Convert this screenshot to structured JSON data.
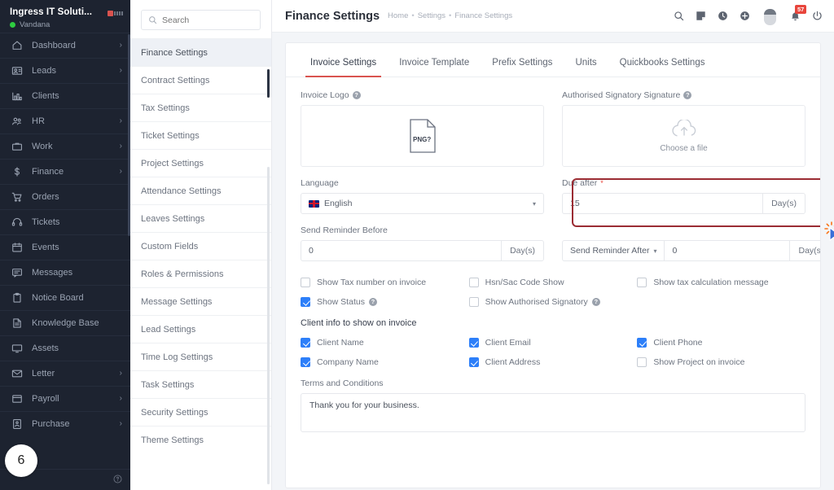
{
  "sidebar": {
    "brand": {
      "name": "Ingress IT Soluti...",
      "user": "Vandana",
      "status": "online"
    },
    "items": [
      {
        "label": "Dashboard",
        "icon": "home-icon",
        "caret": "›"
      },
      {
        "label": "Leads",
        "icon": "leads-icon",
        "caret": "›"
      },
      {
        "label": "Clients",
        "icon": "clients-icon",
        "caret": ""
      },
      {
        "label": "HR",
        "icon": "hr-icon",
        "caret": "›"
      },
      {
        "label": "Work",
        "icon": "work-icon",
        "caret": "›"
      },
      {
        "label": "Finance",
        "icon": "dollar-icon",
        "caret": "›"
      },
      {
        "label": "Orders",
        "icon": "cart-icon",
        "caret": ""
      },
      {
        "label": "Tickets",
        "icon": "headset-icon",
        "caret": ""
      },
      {
        "label": "Events",
        "icon": "calendar-icon",
        "caret": ""
      },
      {
        "label": "Messages",
        "icon": "message-icon",
        "caret": ""
      },
      {
        "label": "Notice Board",
        "icon": "clipboard-icon",
        "caret": ""
      },
      {
        "label": "Knowledge Base",
        "icon": "book-icon",
        "caret": ""
      },
      {
        "label": "Assets",
        "icon": "monitor-icon",
        "caret": ""
      },
      {
        "label": "Letter",
        "icon": "envelope-icon",
        "caret": "›"
      },
      {
        "label": "Payroll",
        "icon": "payroll-icon",
        "caret": "›"
      },
      {
        "label": "Purchase",
        "icon": "purchase-icon",
        "caret": "›"
      }
    ],
    "footer_help_icon": "help-icon",
    "overlay_badge": "6"
  },
  "settings_panel": {
    "search_placeholder": "Search",
    "search_value": "",
    "items": [
      {
        "label": "Finance Settings",
        "active": true
      },
      {
        "label": "Contract Settings",
        "active": false
      },
      {
        "label": "Tax Settings",
        "active": false
      },
      {
        "label": "Ticket Settings",
        "active": false
      },
      {
        "label": "Project Settings",
        "active": false
      },
      {
        "label": "Attendance Settings",
        "active": false
      },
      {
        "label": "Leaves Settings",
        "active": false
      },
      {
        "label": "Custom Fields",
        "active": false
      },
      {
        "label": "Roles & Permissions",
        "active": false
      },
      {
        "label": "Message Settings",
        "active": false
      },
      {
        "label": "Lead Settings",
        "active": false
      },
      {
        "label": "Time Log Settings",
        "active": false
      },
      {
        "label": "Task Settings",
        "active": false
      },
      {
        "label": "Security Settings",
        "active": false
      },
      {
        "label": "Theme Settings",
        "active": false
      }
    ]
  },
  "header": {
    "title": "Finance Settings",
    "breadcrumb": [
      "Home",
      "Settings",
      "Finance Settings"
    ],
    "breadcrumb_sep": "•",
    "icons": [
      "search-icon",
      "note-icon",
      "clock-icon",
      "plus-circle-icon",
      "avatar",
      "bell-icon",
      "power-icon"
    ],
    "notification_count": "57"
  },
  "tabs": [
    {
      "label": "Invoice Settings",
      "active": true
    },
    {
      "label": "Invoice Template",
      "active": false
    },
    {
      "label": "Prefix Settings",
      "active": false
    },
    {
      "label": "Units",
      "active": false
    },
    {
      "label": "Quickbooks Settings",
      "active": false
    }
  ],
  "form": {
    "invoice_logo": {
      "label": "Invoice Logo",
      "file_badge": "PNG?"
    },
    "signature": {
      "label": "Authorised Signatory Signature",
      "choose": "Choose a file"
    },
    "language": {
      "label": "Language",
      "value": "English"
    },
    "due_after": {
      "label": "Due after",
      "value": "15",
      "addon": "Day(s)",
      "required": "*"
    },
    "send_reminder_before": {
      "label": "Send Reminder Before",
      "value": "0",
      "addon": "Day(s)"
    },
    "send_reminder_after": {
      "prefix": "Send Reminder After",
      "value": "0",
      "addon": "Day(s)"
    },
    "checkboxes_row1": [
      {
        "label": "Show Tax number on invoice",
        "checked": false,
        "help": false
      },
      {
        "label": "Hsn/Sac Code Show",
        "checked": false,
        "help": false
      },
      {
        "label": "Show tax calculation message",
        "checked": false,
        "help": false
      }
    ],
    "checkboxes_row2": [
      {
        "label": "Show Status",
        "checked": true,
        "help": true
      },
      {
        "label": "Show Authorised Signatory",
        "checked": false,
        "help": true
      },
      {
        "label": "",
        "checked": false,
        "help": false
      }
    ],
    "client_info_title": "Client info to show on invoice",
    "client_row1": [
      {
        "label": "Client Name",
        "checked": true
      },
      {
        "label": "Client Email",
        "checked": true
      },
      {
        "label": "Client Phone",
        "checked": true
      }
    ],
    "client_row2": [
      {
        "label": "Company Name",
        "checked": true
      },
      {
        "label": "Client Address",
        "checked": true
      },
      {
        "label": "Show Project on invoice",
        "checked": false
      }
    ],
    "terms": {
      "label": "Terms and Conditions",
      "value": "Thank you for your business."
    }
  },
  "colors": {
    "sidebar_bg": "#1d2330",
    "accent_tab": "#d9534f",
    "highlight_border": "#9b2c33",
    "checkbox_on": "#2d7ff9",
    "badge_red": "#e8453c",
    "cursor": "#3a6fd8",
    "burst": "#f97316"
  }
}
